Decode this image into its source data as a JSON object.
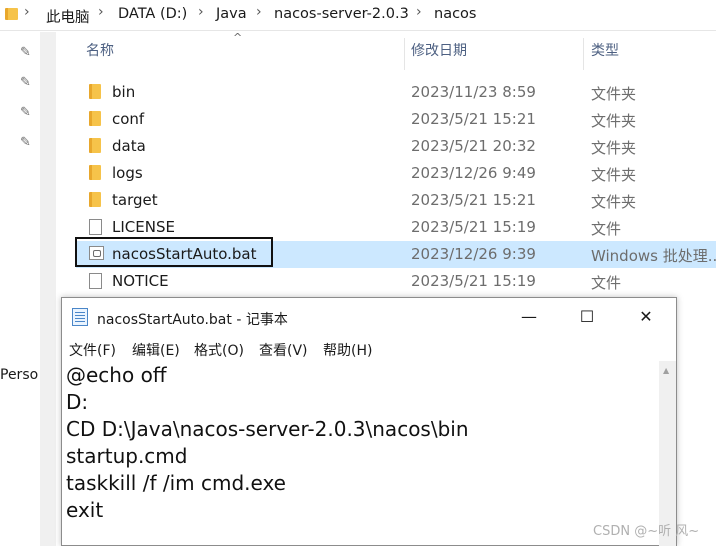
{
  "breadcrumb": {
    "items": [
      "此电脑",
      "DATA (D:)",
      "Java",
      "nacos-server-2.0.3",
      "nacos"
    ],
    "separator": "›"
  },
  "nav": {
    "partial_label": "Perso"
  },
  "columns": {
    "name": "名称",
    "date": "修改日期",
    "type": "类型"
  },
  "files": [
    {
      "name": "bin",
      "date": "2023/11/23 8:59",
      "type": "文件夹",
      "icon": "folder-icon"
    },
    {
      "name": "conf",
      "date": "2023/5/21 15:21",
      "type": "文件夹",
      "icon": "folder-icon"
    },
    {
      "name": "data",
      "date": "2023/5/21 20:32",
      "type": "文件夹",
      "icon": "folder-icon"
    },
    {
      "name": "logs",
      "date": "2023/12/26 9:49",
      "type": "文件夹",
      "icon": "folder-icon"
    },
    {
      "name": "target",
      "date": "2023/5/21 15:21",
      "type": "文件夹",
      "icon": "folder-icon"
    },
    {
      "name": "LICENSE",
      "date": "2023/5/21 15:19",
      "type": "文件",
      "icon": "file-icon"
    },
    {
      "name": "nacosStartAuto.bat",
      "date": "2023/12/26 9:39",
      "type": "Windows 批处理...",
      "icon": "batch-file-icon",
      "selected": true
    },
    {
      "name": "NOTICE",
      "date": "2023/5/21 15:19",
      "type": "文件",
      "icon": "file-icon"
    }
  ],
  "notepad": {
    "title": "nacosStartAuto.bat - 记事本",
    "window_buttons": {
      "minimize": "—",
      "maximize": "☐",
      "close": "✕"
    },
    "menu": [
      "文件(F)",
      "编辑(E)",
      "格式(O)",
      "查看(V)",
      "帮助(H)"
    ],
    "lines": [
      "@echo off",
      "D:",
      "CD D:\\Java\\nacos-server-2.0.3\\nacos\\bin",
      "startup.cmd",
      "taskkill /f /im cmd.exe",
      "exit"
    ]
  },
  "watermark": "CSDN @~听 风~",
  "colors": {
    "selection": "#cce8ff",
    "folder": "#f6c34a",
    "header_text": "#4d6082"
  }
}
